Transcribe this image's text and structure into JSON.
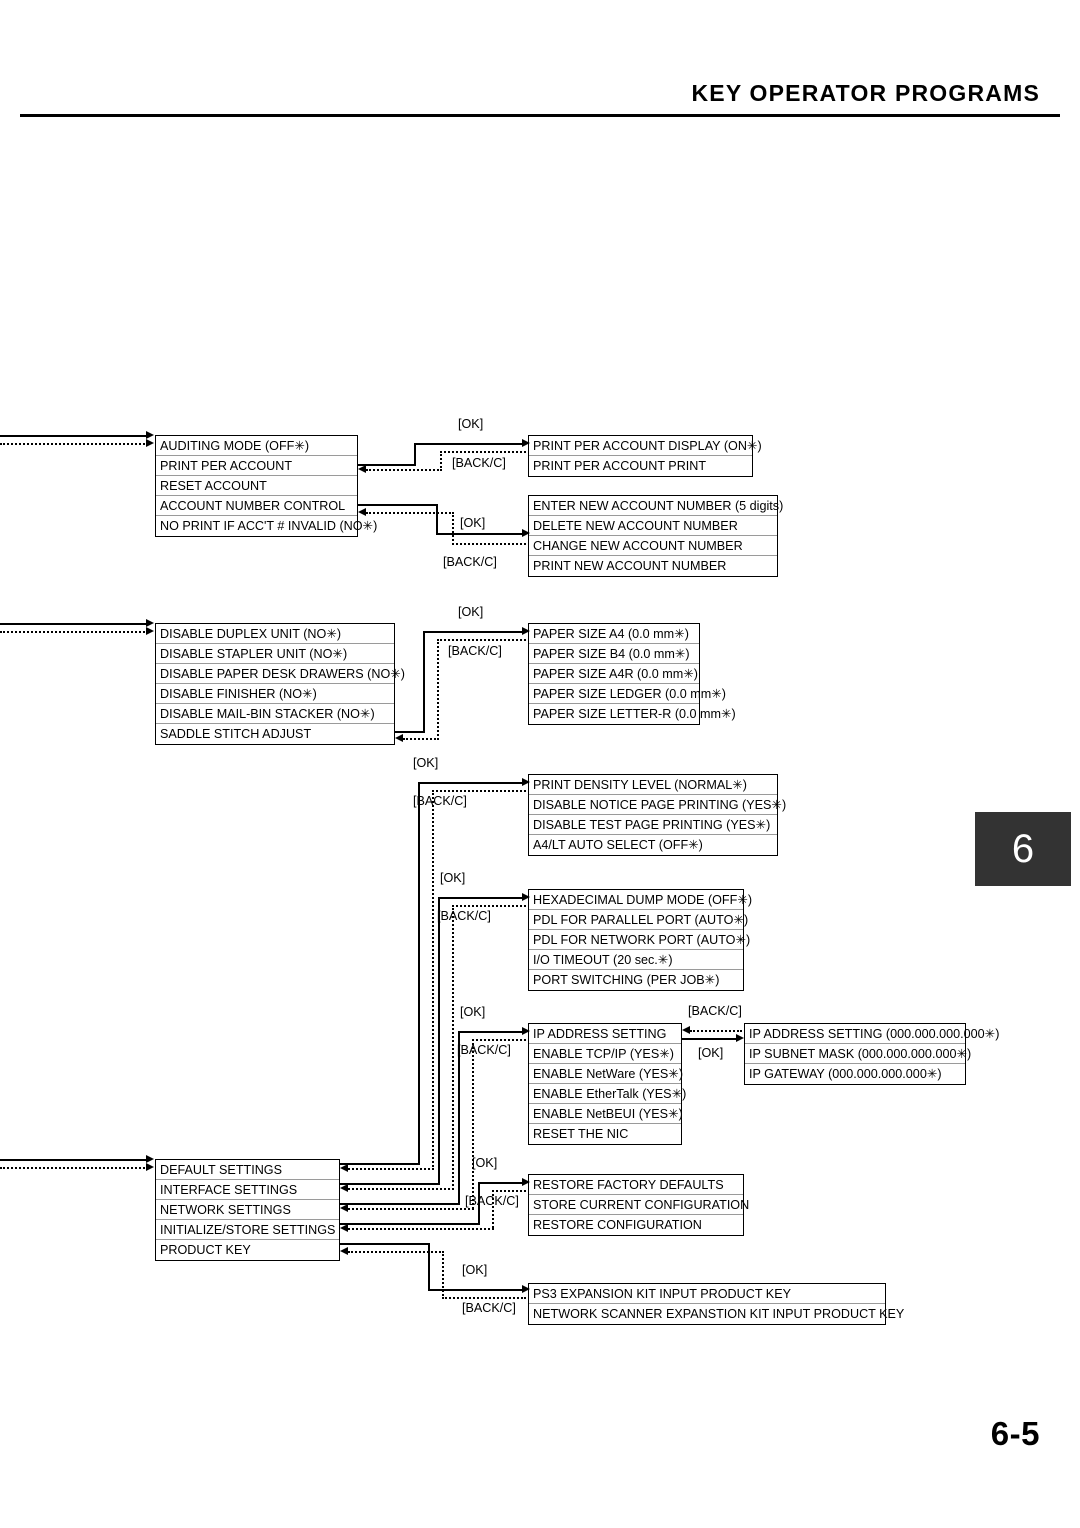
{
  "header": {
    "title": "KEY OPERATOR PROGRAMS"
  },
  "chapter_tab": {
    "number": "6"
  },
  "footer": {
    "page_number": "6-5"
  },
  "labels": {
    "ok": "[OK]",
    "back": "[BACK/C]"
  },
  "menus": {
    "auditing": {
      "name": "auditing-menu",
      "items": [
        "AUDITING MODE (OFF✳)",
        "PRINT PER ACCOUNT",
        "RESET ACCOUNT",
        "ACCOUNT NUMBER CONTROL",
        "NO PRINT IF ACC'T # INVALID (NO✳)"
      ]
    },
    "print_per_account": {
      "name": "print-per-account-submenu",
      "items": [
        "PRINT PER ACCOUNT DISPLAY (ON✳)",
        "PRINT PER ACCOUNT PRINT"
      ]
    },
    "account_number_control": {
      "name": "account-number-control-submenu",
      "items": [
        "ENTER NEW ACCOUNT NUMBER (5 digits)",
        "DELETE NEW ACCOUNT NUMBER",
        "CHANGE NEW ACCOUNT NUMBER",
        "PRINT NEW ACCOUNT NUMBER"
      ]
    },
    "device": {
      "name": "device-menu",
      "items": [
        "DISABLE DUPLEX UNIT (NO✳)",
        "DISABLE STAPLER UNIT (NO✳)",
        "DISABLE PAPER DESK DRAWERS (NO✳)",
        "DISABLE FINISHER (NO✳)",
        "DISABLE MAIL-BIN STACKER (NO✳)",
        "SADDLE STITCH ADJUST"
      ]
    },
    "paper_size": {
      "name": "saddle-stitch-adjust-submenu",
      "items": [
        "PAPER SIZE A4 (0.0 mm✳)",
        "PAPER SIZE B4 (0.0 mm✳)",
        "PAPER SIZE A4R (0.0 mm✳)",
        "PAPER SIZE LEDGER (0.0 mm✳)",
        "PAPER SIZE LETTER-R (0.0 mm✳)"
      ]
    },
    "default_settings": {
      "name": "default-settings-submenu",
      "items": [
        "PRINT DENSITY LEVEL (NORMAL✳)",
        "DISABLE NOTICE PAGE PRINTING (YES✳)",
        "DISABLE TEST PAGE PRINTING (YES✳)",
        "A4/LT AUTO SELECT (OFF✳)"
      ]
    },
    "interface_settings": {
      "name": "interface-settings-submenu",
      "items": [
        "HEXADECIMAL DUMP MODE (OFF✳)",
        "PDL FOR PARALLEL PORT (AUTO✳)",
        "PDL FOR NETWORK PORT (AUTO✳)",
        "I/O TIMEOUT (20 sec.✳)",
        "PORT SWITCHING (PER JOB✳)"
      ]
    },
    "network_settings": {
      "name": "network-settings-submenu",
      "items": [
        "IP ADDRESS SETTING",
        "ENABLE TCP/IP (YES✳)",
        "ENABLE NetWare (YES✳)",
        "ENABLE EtherTalk (YES✳)",
        "ENABLE NetBEUI (YES✳)",
        "RESET THE NIC"
      ]
    },
    "ip_address": {
      "name": "ip-address-setting-submenu",
      "items": [
        "IP ADDRESS SETTING (000.000.000.000✳)",
        "IP SUBNET MASK (000.000.000.000✳)",
        "IP GATEWAY (000.000.000.000✳)"
      ]
    },
    "main": {
      "name": "printer-settings-main-menu",
      "items": [
        "DEFAULT SETTINGS",
        "INTERFACE SETTINGS",
        "NETWORK SETTINGS",
        "INITIALIZE/STORE SETTINGS",
        "PRODUCT KEY"
      ]
    },
    "initialize_store": {
      "name": "initialize-store-settings-submenu",
      "items": [
        "RESTORE FACTORY DEFAULTS",
        "STORE CURRENT CONFIGURATION",
        "RESTORE CONFIGURATION"
      ]
    },
    "product_key": {
      "name": "product-key-submenu",
      "items": [
        "PS3 EXPANSION KIT INPUT PRODUCT KEY",
        "NETWORK SCANNER EXPANSTION KIT INPUT PRODUCT KEY"
      ]
    }
  }
}
